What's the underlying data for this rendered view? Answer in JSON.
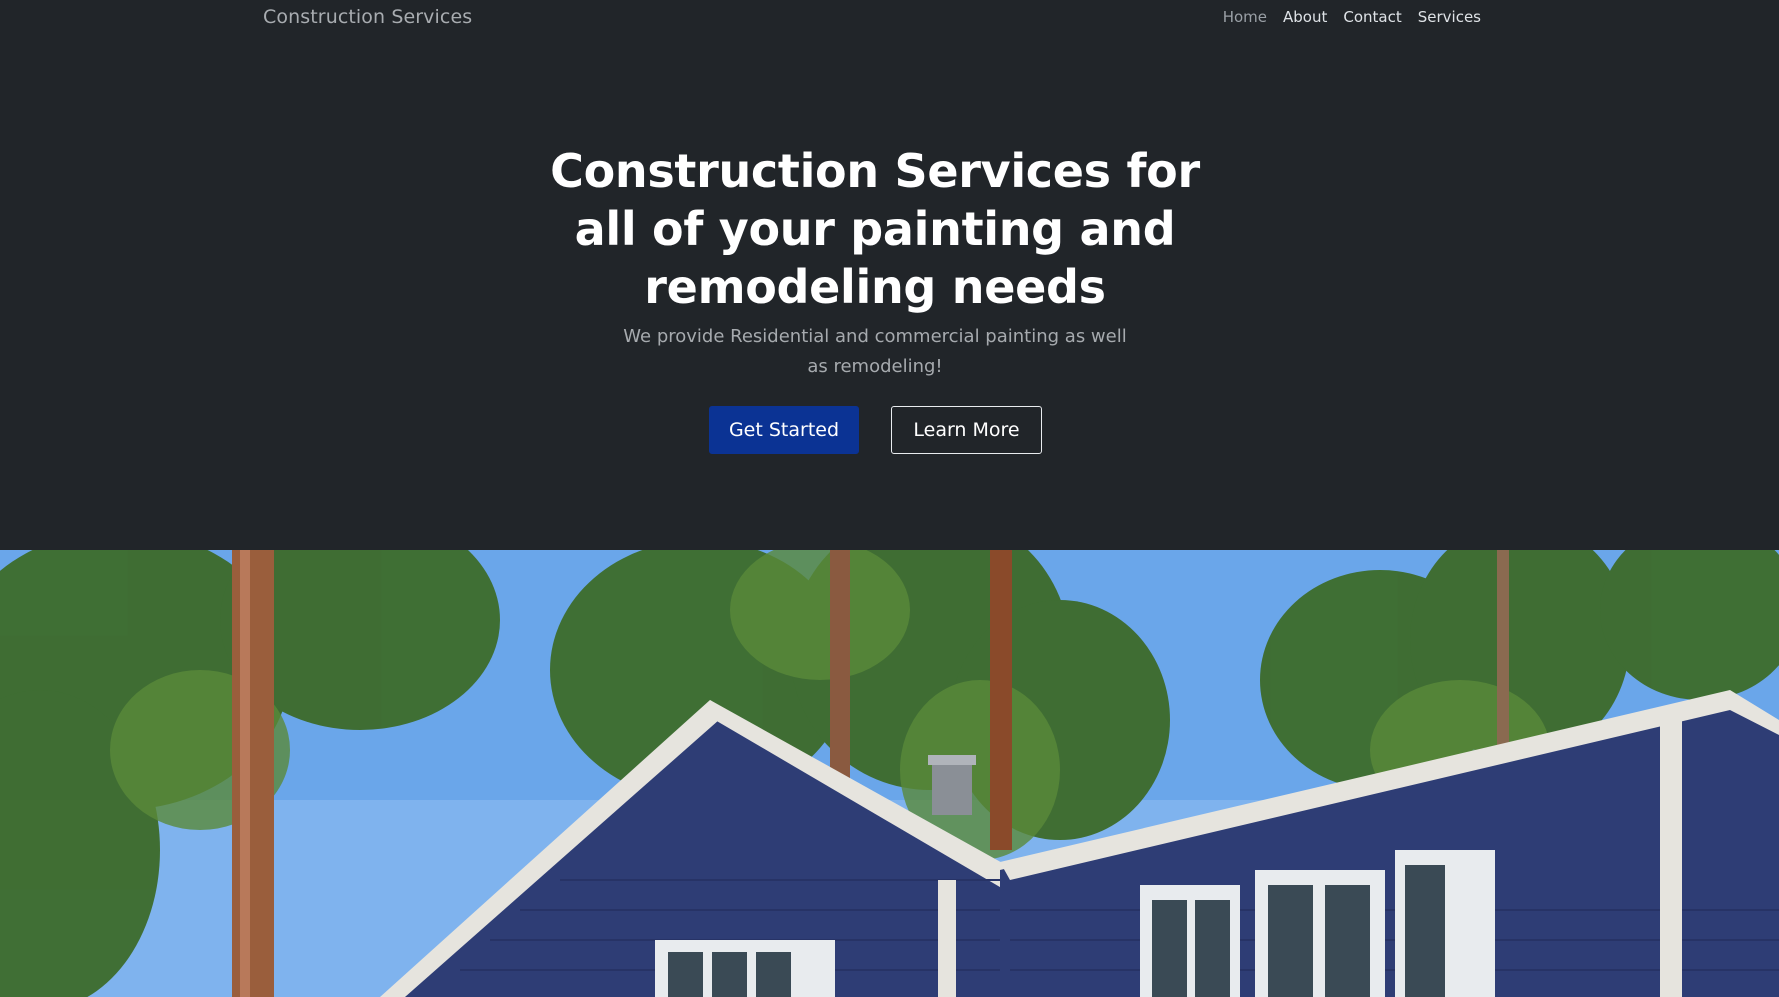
{
  "navbar": {
    "brand": "Construction Services",
    "links": [
      {
        "label": "Home",
        "active": true
      },
      {
        "label": "About",
        "active": false
      },
      {
        "label": "Contact",
        "active": false
      },
      {
        "label": "Services",
        "active": false
      }
    ]
  },
  "hero": {
    "title": "Construction Services for all of your painting and remodeling needs",
    "subtitle": "We provide Residential and commercial painting as well as remodeling!",
    "primary_button": "Get Started",
    "secondary_button": "Learn More"
  },
  "colors": {
    "background": "#212529",
    "primary_button": "#0b3394",
    "house_siding": "#2e3d75",
    "sky": "#5a9ae6",
    "foliage": "#3d6b2a"
  }
}
